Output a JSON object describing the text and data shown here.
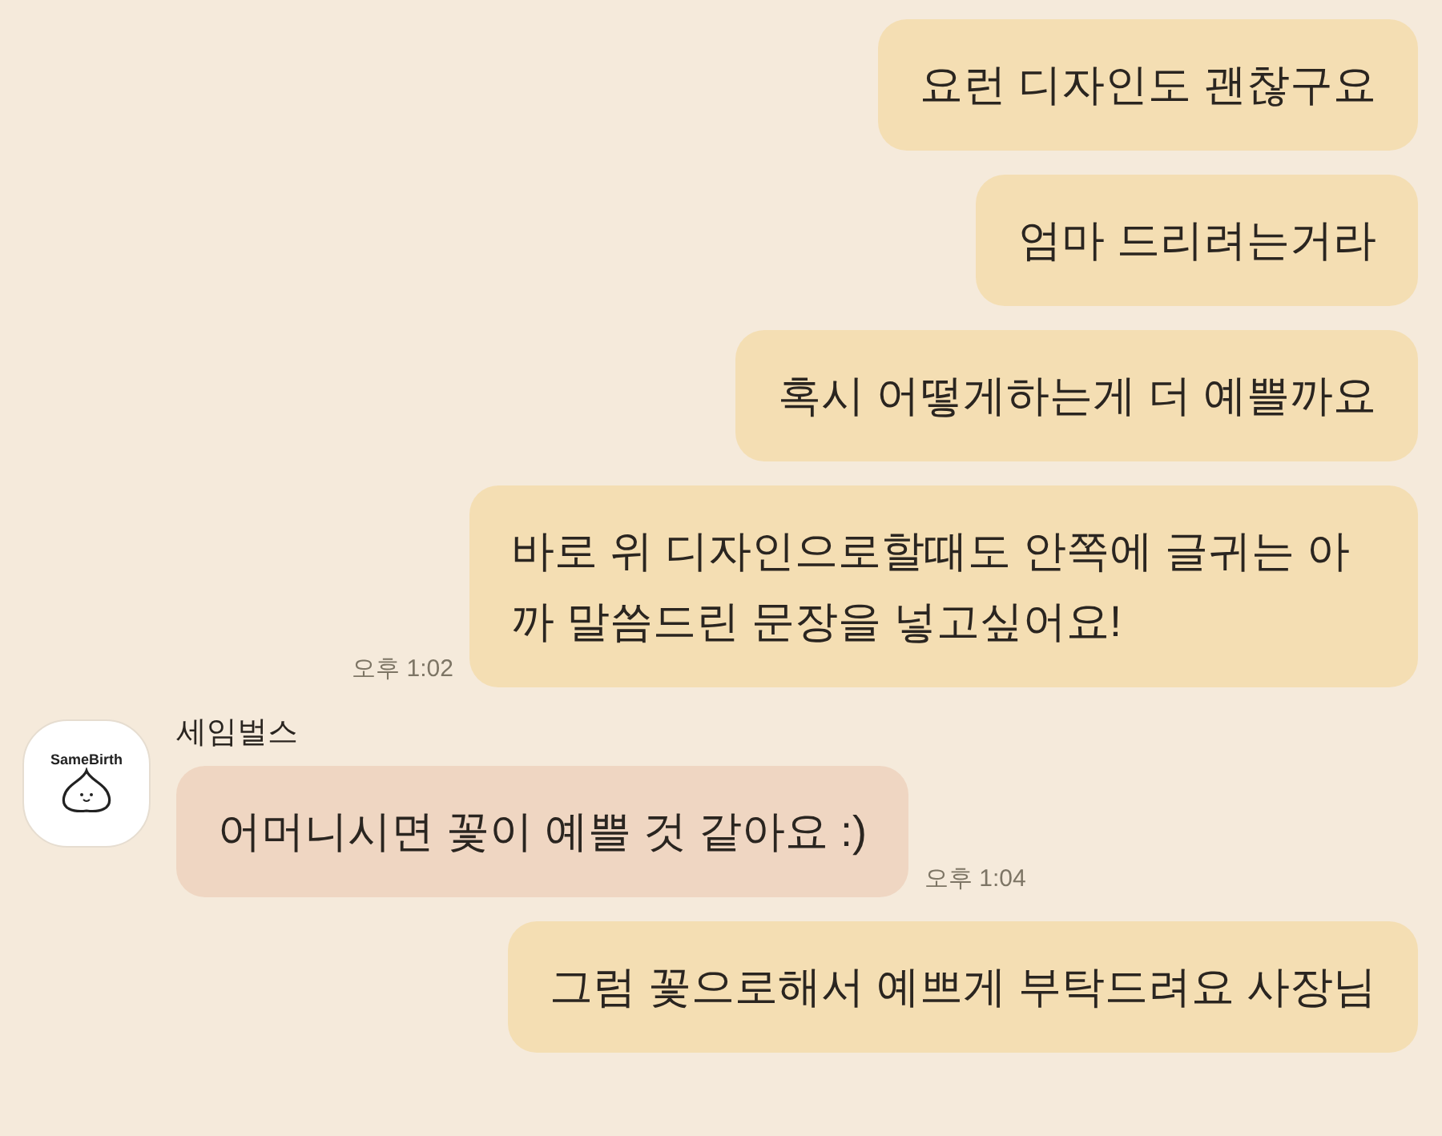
{
  "messages": [
    {
      "kind": "sent",
      "text": "요런 디자인도 괜찮구요"
    },
    {
      "kind": "sent",
      "text": "엄마 드리려는거라"
    },
    {
      "kind": "sent",
      "text": "혹시 어떻게하는게 더 예쁠까요"
    },
    {
      "kind": "sent",
      "text": "바로 위 디자인으로할때도 안쪽에 글귀는 아까 말씀드린 문장을 넣고싶어요!",
      "time": "오후 1:02"
    },
    {
      "kind": "received",
      "sender": "세임벌스",
      "avatar_logo": "SameBirth",
      "text": "어머니시면 꽃이 예쁠 것 같아요 :)",
      "time": "오후 1:04"
    },
    {
      "kind": "sent",
      "text": "그럼 꽃으로해서 예쁘게 부탁드려요 사장님"
    }
  ]
}
